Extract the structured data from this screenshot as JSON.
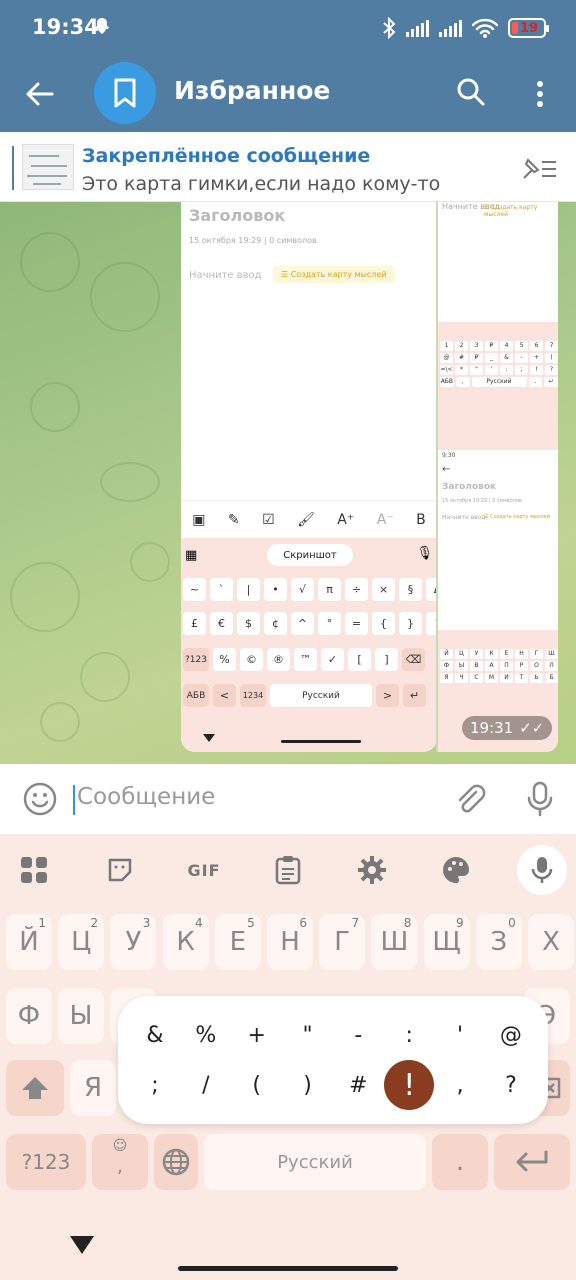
{
  "status": {
    "time": "19:34",
    "battery": "19"
  },
  "header": {
    "title": "Избранное"
  },
  "pinned": {
    "title": "Закреплённое сообщение",
    "text": "Это карта гимки,если надо кому-то"
  },
  "message": {
    "time": "19:31",
    "shot1": {
      "note_title": "Заголовок",
      "note_meta": "15 октября  19:29  |  0 символов",
      "note_placeholder": "Начните ввод",
      "mindmap_chip": "☰ Создать карту мыслей",
      "suggestion": "Скриншот",
      "row1": [
        "~",
        "`",
        "|",
        "•",
        "√",
        "π",
        "÷",
        "×",
        "§",
        "Δ"
      ],
      "row2": [
        "£",
        "€",
        "$",
        "¢",
        "^",
        "°",
        "=",
        "{",
        "}",
        "\\"
      ],
      "row3_left": "?123",
      "row3": [
        "%",
        "©",
        "®",
        "™",
        "✓",
        "[",
        "]"
      ],
      "row4_left": "АБВ",
      "row4_lt": "<",
      "row4_num": "1234",
      "row4_space": "Русский",
      "row4_gt": ">"
    },
    "shot2": {
      "time": "9:30",
      "note_title": "Заголовок",
      "note_meta": "15 октября  19:29  |  0 символов",
      "note_placeholder": "Начните ввод",
      "mindmap_chip": "☰ Создать карту мыслей",
      "space": "Русский"
    }
  },
  "input": {
    "placeholder": "Сообщение"
  },
  "keyboard": {
    "toolbar": [
      "apps-icon",
      "sticker-icon",
      "GIF",
      "clipboard-icon",
      "gear-icon",
      "palette-icon",
      "mic-icon"
    ],
    "gif_label": "GIF",
    "row1": [
      {
        "k": "Й",
        "h": "1"
      },
      {
        "k": "Ц",
        "h": "2"
      },
      {
        "k": "У",
        "h": "3"
      },
      {
        "k": "К",
        "h": "4"
      },
      {
        "k": "Е",
        "h": "5"
      },
      {
        "k": "Н",
        "h": "6"
      },
      {
        "k": "Г",
        "h": "7"
      },
      {
        "k": "Ш",
        "h": "8"
      },
      {
        "k": "Щ",
        "h": "9"
      },
      {
        "k": "З",
        "h": "0"
      },
      {
        "k": "Х",
        "h": ""
      }
    ],
    "row2_visible": [
      "Ф",
      "Ы",
      "Э"
    ],
    "row3_visible": [
      "Я"
    ],
    "fn_left": "?123",
    "emoji_comma": ",",
    "space": "Русский",
    "dot": ".",
    "popup_row1": [
      "&",
      "%",
      "+",
      "\"",
      "-",
      ":",
      "'",
      "@"
    ],
    "popup_row2": [
      ";",
      "/",
      "(",
      ")",
      "#",
      "!",
      ",",
      "?"
    ],
    "popup_selected": "!"
  },
  "colors": {
    "header": "#517da2",
    "accent": "#2b79c2",
    "key_bg": "#fff5f2",
    "selected": "#8a3c20"
  }
}
